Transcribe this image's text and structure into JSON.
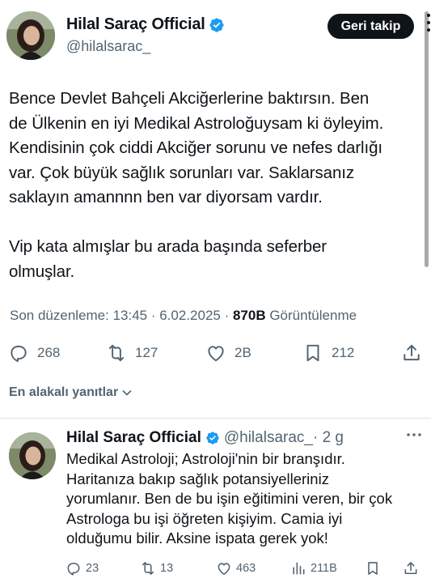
{
  "tweet": {
    "author_name": "Hilal Saraç Official",
    "author_handle": "@hilalsarac_",
    "follow_label": "Geri takip",
    "text": "Bence Devlet Bahçeli Akciğerlerine baktırsın. Ben\nde Ülkenin en iyi Medikal Astroloğuysam ki öyleyim.\nKendisinin çok ciddi Akciğer sorunu ve nefes darlığı\nvar. Çok büyük sağlık sorunları var. Saklarsanız\nsaklayın amannnn ben var diyorsam vardır.\n\nVip kata almışlar bu arada başında seferber\nolmuşlar.",
    "edited_label": "Son düzenleme: 13:45 · 6.02.2025 · ",
    "views_count": "870B",
    "views_label": " Görüntülenme",
    "stats": {
      "replies": "268",
      "reposts": "127",
      "likes": "2B",
      "bookmarks": "212"
    }
  },
  "replies_sort": {
    "label": "En alakalı yanıtlar"
  },
  "reply": {
    "author_name": "Hilal Saraç Official",
    "author_handle": "@hilalsarac_",
    "time": " · 2 g",
    "text": "Medikal Astroloji; Astroloji'nin bir branşıdır.\nHaritanıza bakıp sağlık potansiyelleriniz\nyorumlanır. Ben de bu işin eğitimini veren, bir çok\nAstrologa bu işi öğreten kişiyim. Camia iyi\nolduğumu bilir. Aksine ispata gerek yok!",
    "stats": {
      "replies": "23",
      "reposts": "13",
      "likes": "463",
      "views": "211B"
    }
  },
  "colors": {
    "text_primary": "#0f1419",
    "text_secondary": "#536471",
    "verified_blue": "#1d9bf0",
    "divider": "#dfe3e6"
  },
  "icons": {
    "verified": "verified-badge-icon",
    "reply": "reply-icon",
    "repost": "repost-icon",
    "like": "heart-icon",
    "bookmark": "bookmark-icon",
    "share": "share-icon",
    "views": "views-bar-icon",
    "more": "more-icon",
    "chevron": "chevron-down-icon"
  }
}
